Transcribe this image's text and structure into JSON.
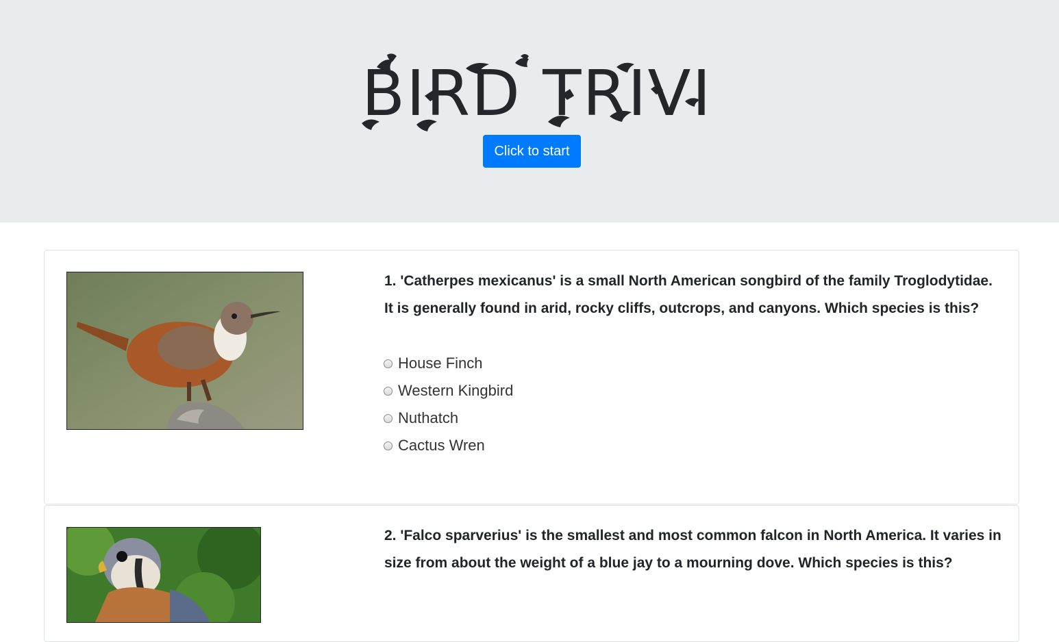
{
  "header": {
    "logo_text": "BIRD TRIVIA",
    "start_button": "Click to start",
    "background": "#e9ecef",
    "button_color": "#007bff"
  },
  "questions": [
    {
      "text": "1. 'Catherpes mexicanus' is a small North American songbird of the family Troglodytidae. It is generally found in arid, rocky cliffs, outcrops, and canyons. Which species is this?",
      "image": "canyon-wren-photo",
      "options": [
        "House Finch",
        "Western Kingbird",
        "Nuthatch",
        "Cactus Wren"
      ]
    },
    {
      "text": "2. 'Falco sparverius' is the smallest and most common falcon in North America. It varies in size from about the weight of a blue jay to a mourning dove. Which species is this?",
      "image": "american-kestrel-photo",
      "options": []
    }
  ]
}
